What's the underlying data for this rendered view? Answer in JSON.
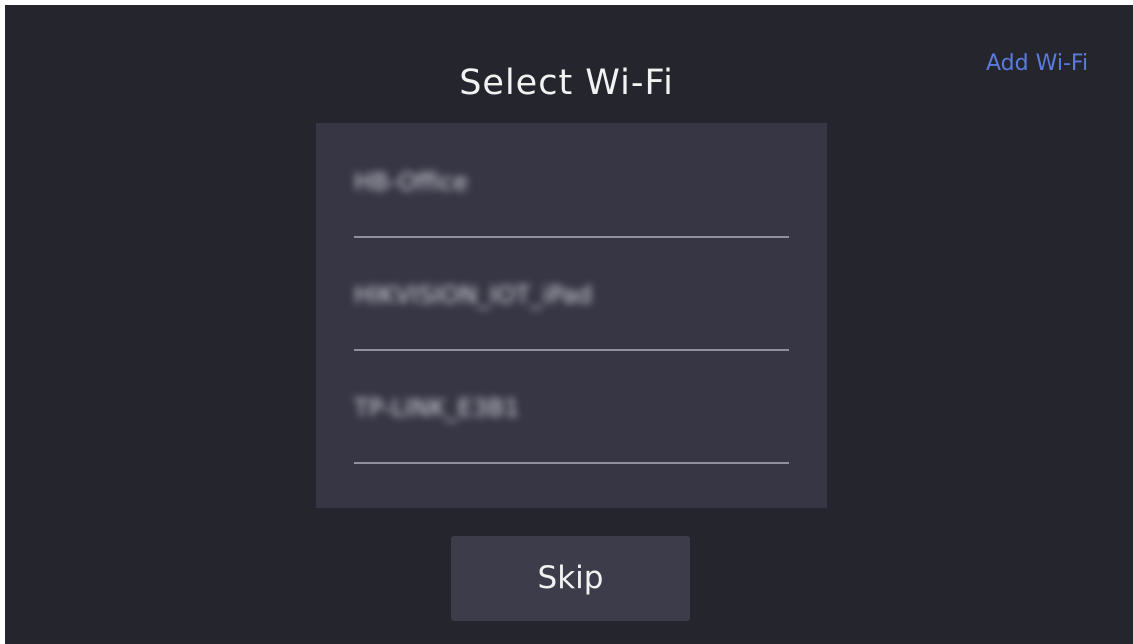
{
  "header": {
    "title": "Select Wi-Fi",
    "add_wifi_label": "Add Wi-Fi"
  },
  "wifi_list": {
    "items": [
      {
        "ssid": "HB-Office"
      },
      {
        "ssid": "HIKVISION_IOT_iPad"
      },
      {
        "ssid": "TP-LINK_E3B1"
      }
    ]
  },
  "footer": {
    "skip_label": "Skip"
  },
  "colors": {
    "background": "#25252e",
    "panel": "#373645",
    "button": "#3d3c4a",
    "link_accent": "#5b7bdc",
    "divider": "#8f8fa0"
  }
}
